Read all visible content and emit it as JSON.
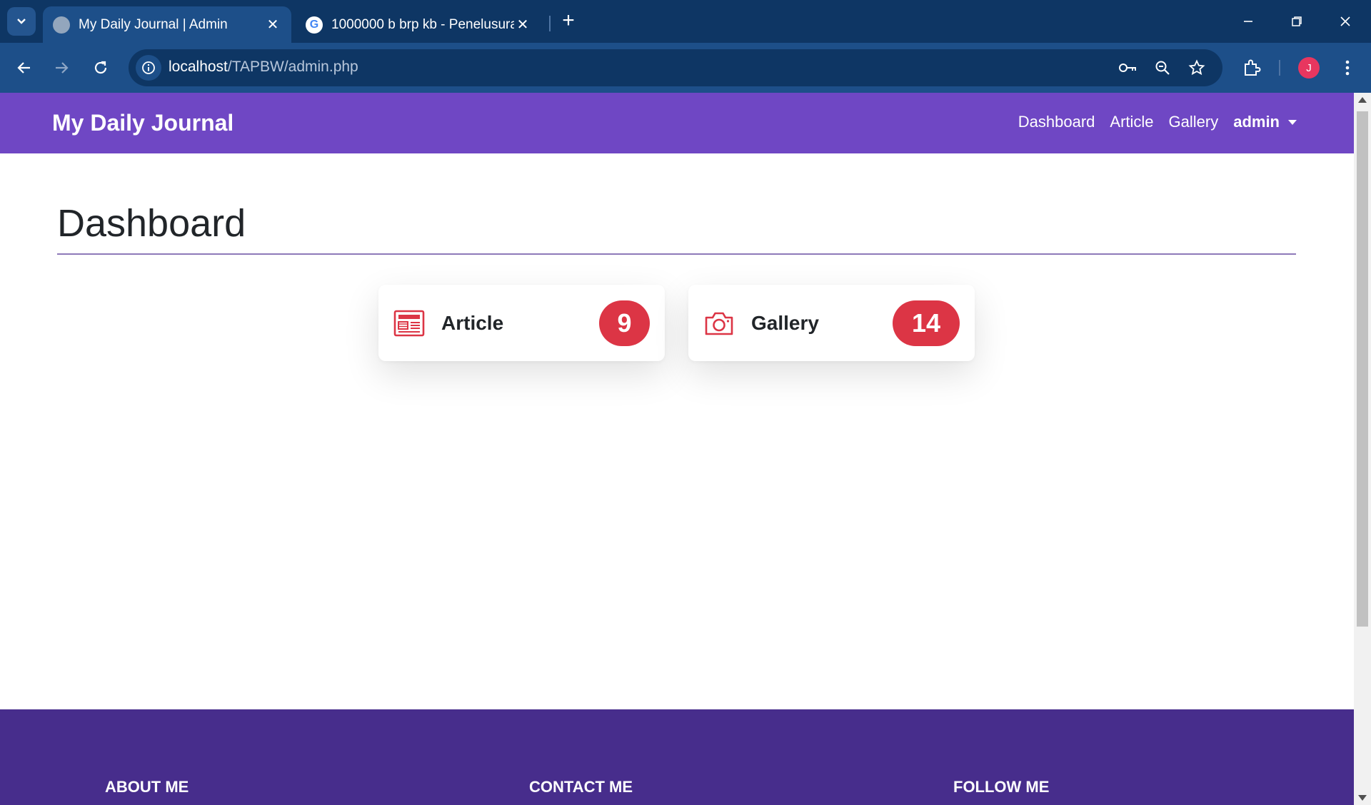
{
  "browser": {
    "tabs": [
      {
        "title": "My Daily Journal | Admin",
        "active": true,
        "favicon": "globe-icon"
      },
      {
        "title": "1000000 b brp kb - Penelusuran",
        "active": false,
        "favicon": "google-icon"
      }
    ],
    "google_favicon_letter": "G",
    "url_host": "localhost",
    "url_path": "/TAPBW/admin.php",
    "profile_initial": "J"
  },
  "site": {
    "brand": "My Daily Journal",
    "nav": {
      "links": [
        "Dashboard",
        "Article",
        "Gallery"
      ],
      "user": "admin"
    },
    "colors": {
      "navbar": "#6f47c4",
      "footer": "#472d8c",
      "badge": "#dc3545",
      "icon": "#dc3545"
    }
  },
  "main": {
    "title": "Dashboard",
    "cards": [
      {
        "label": "Article",
        "count": "9",
        "icon": "newspaper-icon"
      },
      {
        "label": "Gallery",
        "count": "14",
        "icon": "camera-icon"
      }
    ]
  },
  "footer": {
    "headings": [
      "ABOUT ME",
      "CONTACT ME",
      "FOLLOW ME"
    ]
  }
}
